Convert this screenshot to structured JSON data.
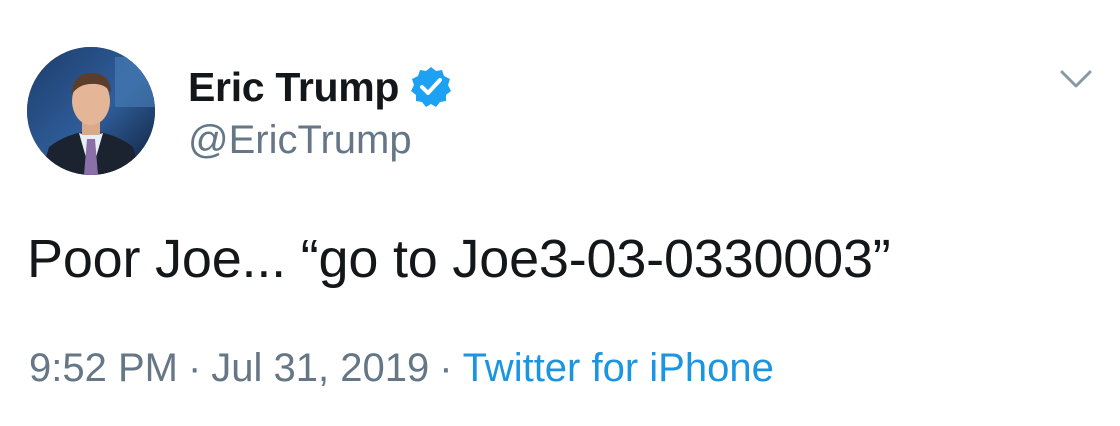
{
  "author": {
    "display_name": "Eric Trump",
    "handle": "@EricTrump",
    "verified": true
  },
  "tweet": {
    "text": "Poor Joe... “go to Joe3-03-0330003”"
  },
  "meta": {
    "time": "9:52 PM",
    "separator": "·",
    "date": "Jul 31, 2019",
    "source": "Twitter for iPhone"
  },
  "icons": {
    "verified": "verified-badge-icon",
    "caret": "chevron-down-icon"
  },
  "colors": {
    "text": "#14171a",
    "muted": "#657786",
    "link": "#1b95e0",
    "verified": "#1da1f2"
  }
}
